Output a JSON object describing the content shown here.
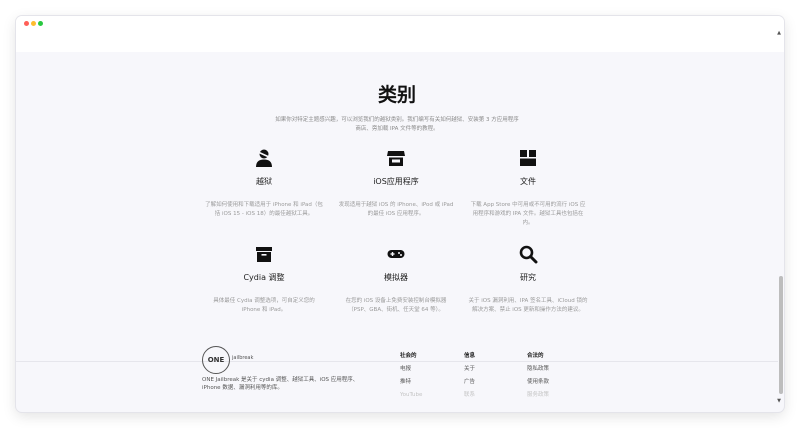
{
  "page": {
    "heading": "类别",
    "intro": "如果你对特定主题感兴趣，可以浏览我们的越狱类别。我们编写有关如何越狱、安装第 3 方应用程序商店、旁加载 IPA 文件等的教程。"
  },
  "categories": [
    {
      "icon": "jailbreak-user-icon",
      "title": "越狱",
      "desc": "了解如何使用和下载适用于 iPhone 和 iPad（包括 iOS 15 - iOS 18）的最佳越狱工具。"
    },
    {
      "icon": "store-icon",
      "title": "iOS应用程序",
      "desc": "发现适用于越狱 iOS 的 iPhone、iPod 或 iPad 的最佳 iOS 应用程序。"
    },
    {
      "icon": "file-icon",
      "title": "文件",
      "desc": "下载 App Store 中可用或不可用的流行 iOS 应用程序和游戏的 IPA 文件。越狱工具也包括在内。"
    },
    {
      "icon": "archive-box-icon",
      "title": "Cydia 调整",
      "desc": "具体最佳 Cydia 调整选项，可自定义您的 iPhone 和 iPad。"
    },
    {
      "icon": "gamepad-icon",
      "title": "模拟器",
      "desc": "在您的 iOS 设备上免费安装控制台模拟器（PSP、GBA、街机、任天堂 64 等）。"
    },
    {
      "icon": "search-icon",
      "title": "研究",
      "desc": "关于 iOS 漏洞利用、IPA 签名工具、iCloud 锁的解决方案、禁止 iOS 更新和操作方法的建议。"
    }
  ],
  "footer": {
    "logo": "ONE",
    "logo_sub": "jailbreak",
    "desc": "ONE Jailbreak 是关于 cydia 调整、越狱工具、iOS 应用程序、iPhone 数据、漏洞利用等的库。",
    "columns": [
      {
        "heading": "社会的",
        "links": [
          "电报",
          "推特"
        ],
        "faded": "YouTube"
      },
      {
        "heading": "信息",
        "links": [
          "关于",
          "广告"
        ],
        "faded": "联系"
      },
      {
        "heading": "合法的",
        "links": [
          "隐私政策",
          "使用条款"
        ],
        "faded": "服务政策"
      }
    ]
  },
  "colors": {
    "window_bg": "#f7f7fb",
    "text_dark": "#111111",
    "text_muted": "#9a9a9a"
  }
}
